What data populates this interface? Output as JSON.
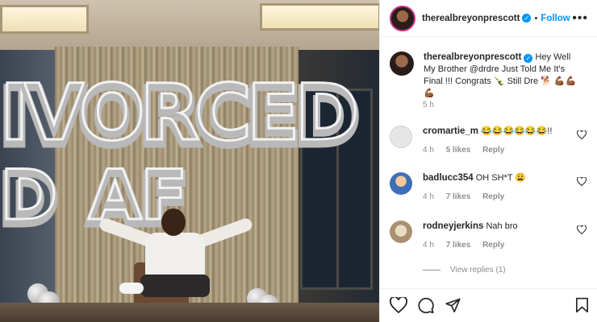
{
  "post": {
    "username": "therealbreyonprescott",
    "follow_label": "Follow",
    "caption": "Hey Well My Brother @drdre Just Told Me It's Final !!! Congrats 🍾 Still Dre 🐕 💪🏾💪🏾💪🏾",
    "caption_time": "5 h",
    "balloon_line1": "IVORCED",
    "balloon_line2": "D AF"
  },
  "comments": [
    {
      "username": "cromartie_m",
      "text": "😂😂😂😂😂😂!!",
      "time": "4 h",
      "likes": "5 likes",
      "reply_label": "Reply",
      "avatar_color": "#dcdcdc"
    },
    {
      "username": "badlucc354",
      "text": "OH SH*T 😩",
      "time": "4 h",
      "likes": "7 likes",
      "reply_label": "Reply",
      "avatar_color": "#3c6fb8"
    },
    {
      "username": "rodneyjerkins",
      "text": "Nah bro",
      "time": "4 h",
      "likes": "7 likes",
      "reply_label": "Reply",
      "avatar_color": "#c9b48a"
    }
  ],
  "view_replies": "View replies (1)",
  "icons": {
    "more": "more-icon",
    "heart": "heart-icon",
    "comment": "comment-icon",
    "share": "share-icon",
    "bookmark": "bookmark-icon",
    "verified": "verified-badge-icon"
  },
  "colors": {
    "accent": "#0095f6",
    "muted": "#8e8e8e",
    "text": "#262626"
  }
}
